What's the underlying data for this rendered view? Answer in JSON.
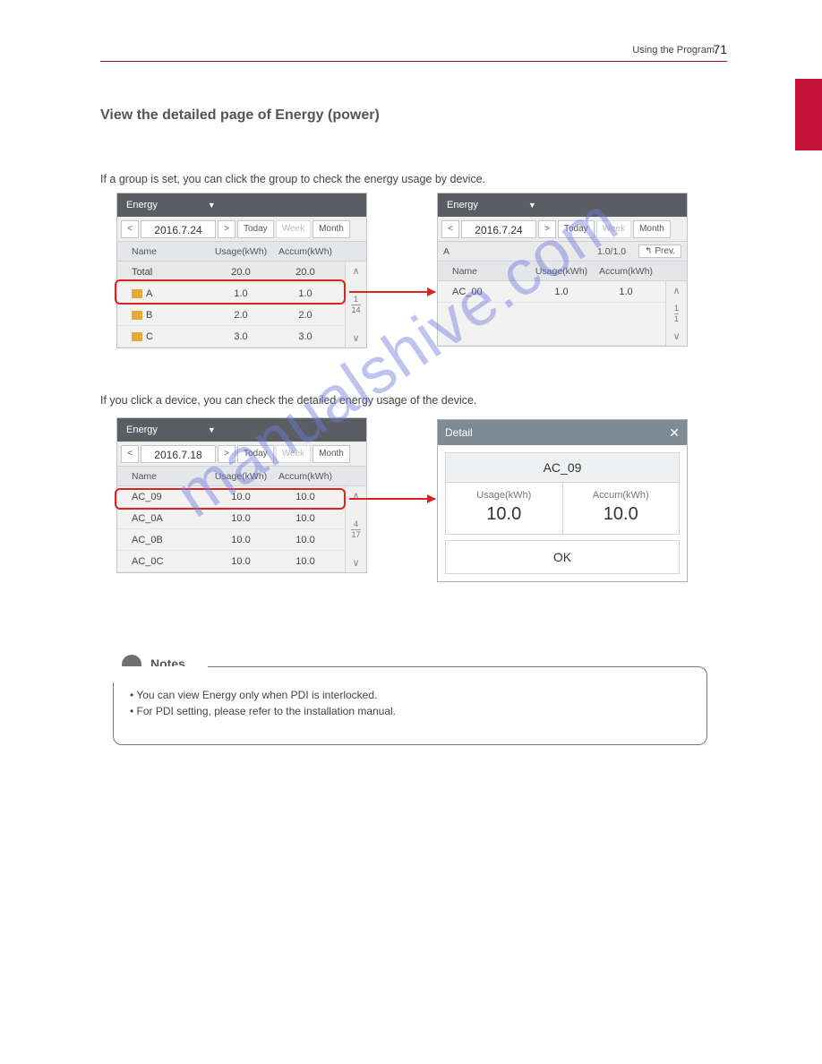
{
  "header": {
    "section": "Using the Program",
    "page_no": "71"
  },
  "title": "View the detailed page of Energy (power)",
  "instr1": "If a group is set, you can click the group to check the energy usage by device.",
  "instr2": "If you click a device, you can check the detailed energy usage of the device.",
  "panel_a": {
    "dropdown": "Energy",
    "date": "2016.7.24",
    "buttons": {
      "today": "Today",
      "week": "Week",
      "month": "Month"
    },
    "cols": {
      "name": "Name",
      "usage": "Usage(kWh)",
      "accum": "Accum(kWh)"
    },
    "rows": [
      {
        "name": "Total",
        "usage": "20.0",
        "accum": "20.0",
        "type": "total"
      },
      {
        "name": "A",
        "usage": "1.0",
        "accum": "1.0",
        "type": "folder"
      },
      {
        "name": "B",
        "usage": "2.0",
        "accum": "2.0",
        "type": "folder"
      },
      {
        "name": "C",
        "usage": "3.0",
        "accum": "3.0",
        "type": "folder"
      }
    ],
    "scroll": {
      "top": "1",
      "bot": "14"
    }
  },
  "panel_b": {
    "dropdown": "Energy",
    "date": "2016.7.24",
    "buttons": {
      "today": "Today",
      "week": "Week",
      "month": "Month"
    },
    "crumb": {
      "name": "A",
      "ratio": "1.0/1.0",
      "prev": "Prev."
    },
    "cols": {
      "name": "Name",
      "usage": "Usage(kWh)",
      "accum": "Accum(kWh)"
    },
    "rows": [
      {
        "name": "AC_00",
        "usage": "1.0",
        "accum": "1.0"
      }
    ],
    "scroll": {
      "top": "1",
      "bot": "1"
    }
  },
  "panel_c": {
    "dropdown": "Energy",
    "date": "2016.7.18",
    "buttons": {
      "today": "Today",
      "week": "Week",
      "month": "Month"
    },
    "cols": {
      "name": "Name",
      "usage": "Usage(kWh)",
      "accum": "Accum(kWh)"
    },
    "rows": [
      {
        "name": "AC_09",
        "usage": "10.0",
        "accum": "10.0"
      },
      {
        "name": "AC_0A",
        "usage": "10.0",
        "accum": "10.0"
      },
      {
        "name": "AC_0B",
        "usage": "10.0",
        "accum": "10.0"
      },
      {
        "name": "AC_0C",
        "usage": "10.0",
        "accum": "10.0"
      }
    ],
    "scroll": {
      "top": "4",
      "bot": "17"
    }
  },
  "detail": {
    "title": "Detail",
    "device": "AC_09",
    "usage_lbl": "Usage(kWh)",
    "usage_val": "10.0",
    "accum_lbl": "Accum(kWh)",
    "accum_val": "10.0",
    "ok": "OK"
  },
  "notes": {
    "label": "Notes",
    "line1": "• You can view Energy only when PDI is interlocked.",
    "line2": "• For PDI setting, please refer to the installation manual."
  },
  "watermark": "manualshive.com"
}
